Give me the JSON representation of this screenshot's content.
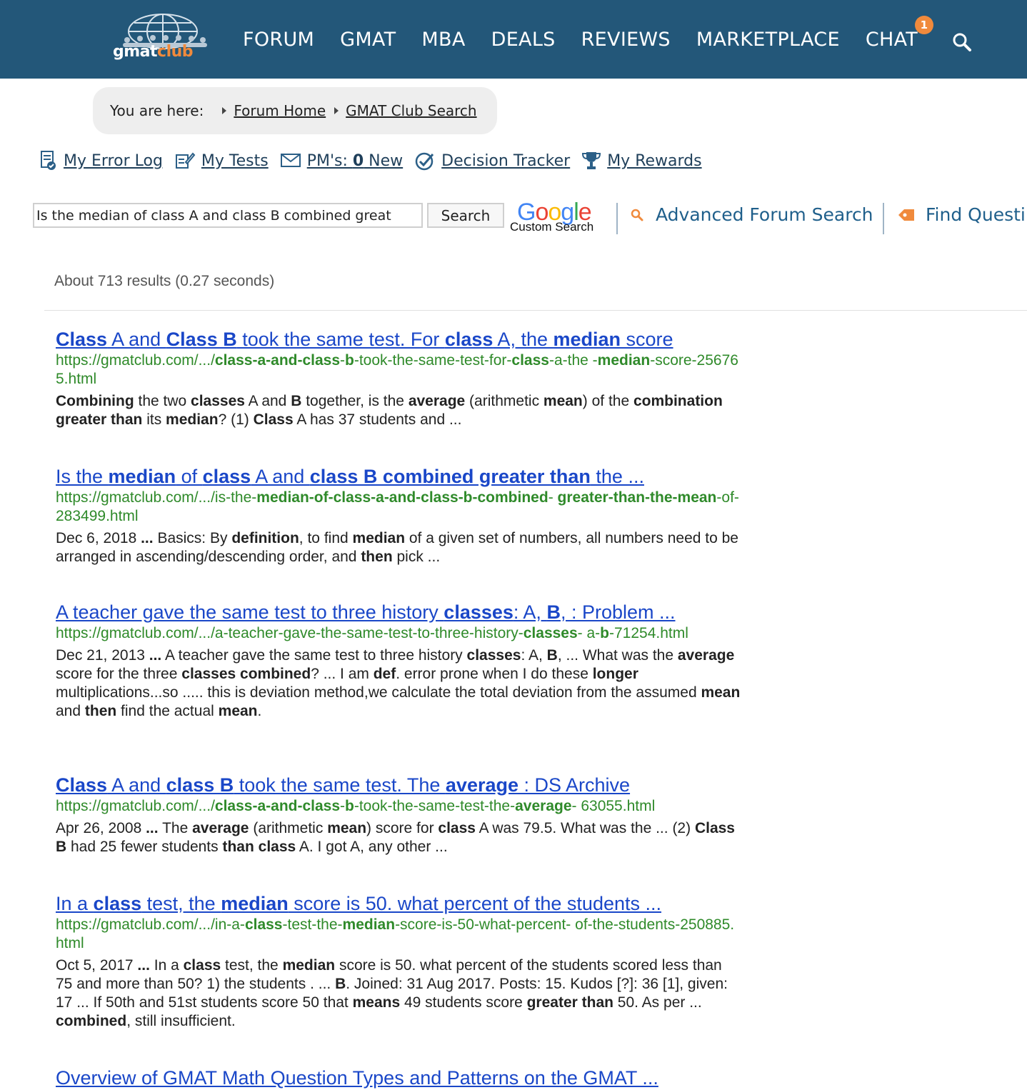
{
  "header": {
    "logo": {
      "part1": "gmat",
      "part2": "club"
    },
    "nav": [
      "FORUM",
      "GMAT",
      "MBA",
      "DEALS",
      "REVIEWS",
      "MARKETPLACE",
      "CHAT"
    ],
    "chat_badge": "1",
    "bg_color": "#235779",
    "accent_color": "#f08a3c"
  },
  "breadcrumb": {
    "label": "You are here:",
    "items": [
      "Forum Home",
      "GMAT Club Search"
    ]
  },
  "tools": [
    {
      "icon": "error-log-icon",
      "label": "My Error Log"
    },
    {
      "icon": "tests-icon",
      "label": "My Tests"
    },
    {
      "icon": "mail-icon",
      "label_prefix": "PM's: ",
      "count": "0",
      "label_suffix": " New"
    },
    {
      "icon": "check-circle-icon",
      "label": "Decision Tracker"
    },
    {
      "icon": "trophy-icon",
      "label": "My Rewards"
    }
  ],
  "search": {
    "value": "Is the median of class A and class B combined great",
    "button": "Search",
    "google_label": "Google",
    "custom_label": "Custom Search",
    "advanced": "Advanced Forum Search",
    "find": "Find Questi"
  },
  "stats": "About 713 results (0.27 seconds)",
  "results": [
    {
      "title_html": "<b>Class</b> A and <b>Class B</b> took the same test. For <b>class</b> A, the <b>median</b> score",
      "url_html": "https://gmatclub.com/.../<b>class-a-and-class</b>-<b>b</b>-took-the-same-test-for-<b>class</b>-a-the -<b>median</b>-score-256765.html",
      "snippet_html": "<b>Combining</b> the two <b>classes</b> A and <b>B</b> together, is the <b>average</b> (arithmetic <b>mean</b>) of the <b>combination greater than</b> its <b>median</b>? (1) <b>Class</b> A has 37 students and ..."
    },
    {
      "title_html": "Is the <b>median</b> of <b>class</b> A and <b>class B combined greater than</b> the ...",
      "url_html": "https://gmatclub.com/.../is-the-<b>median-of-class-a-and-class-b-combined</b>- <b>greater-than-the-mean</b>-of-283499.html",
      "snippet_html": "Dec 6, 2018 <b>...</b> Basics: By <b>definition</b>, to find <b>median</b> of a given set of numbers, all numbers need to be arranged in ascending/descending order, and <b>then</b> pick ..."
    },
    {
      "title_html": "A teacher gave the same test to three history <b>classes</b>: A, <b>B</b>, : Problem ...",
      "url_html": "https://gmatclub.com/.../a-teacher-gave-the-same-test-to-three-history-<b>classes</b>- a-<b>b</b>-71254.html",
      "snippet_html": "Dec 21, 2013 <b>...</b> A teacher gave the same test to three history <b>classes</b>: A, <b>B</b>, ... What was the <b>average</b> score for the three <b>classes combined</b>? ... I am <b>def</b>. error prone when I do these <b>longer</b> multiplications...so ..... this is deviation method,we calculate the total deviation from the assumed <b>mean</b> and <b>then</b> find the actual <b>mean</b>."
    },
    {
      "title_html": "<b>Class</b> A and <b>class B</b> took the same test. The <b>average</b> : DS Archive",
      "url_html": "https://gmatclub.com/.../<b>class-a-and-class</b>-<b>b</b>-took-the-same-test-the-<b>average</b>- 63055.html",
      "snippet_html": "Apr 26, 2008 <b>...</b> The <b>average</b> (arithmetic <b>mean</b>) score for <b>class</b> A was 79.5. What was the ... (2) <b>Class B</b> had 25 fewer students <b>than class</b> A. I got A, any other ..."
    },
    {
      "title_html": "In a <b>class</b> test, the <b>median</b> score is 50. what percent of the students ...",
      "url_html": "https://gmatclub.com/.../in-a-<b>class</b>-test-the-<b>median</b>-score-is-50-what-percent- of-the-students-250885.html",
      "snippet_html": "Oct 5, 2017 <b>...</b> In a <b>class</b> test, the <b>median</b> score is 50. what percent of the students scored less than 75 and more than 50? 1) the students . ... <b>B</b>. Joined: 31 Aug 2017. Posts: 15. Kudos [?]: 36 [1], given: 17 ... If 50th and 51st students score 50 that <b>means</b> 49 students score <b>greater than</b> 50. As per ... <b>combined</b>, still insufficient."
    },
    {
      "title_html": "Overview of GMAT Math Question Types and Patterns on the GMAT ...",
      "url_html": "",
      "snippet_html": ""
    }
  ]
}
